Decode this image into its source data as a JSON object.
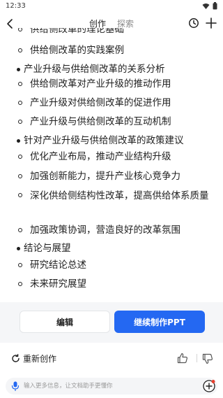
{
  "status_bar": {
    "time": "12:33"
  },
  "header": {
    "tabs": [
      {
        "label": "创作",
        "active": true
      },
      {
        "label": "探索",
        "active": false
      }
    ]
  },
  "outline": {
    "items": [
      {
        "level": 2,
        "text": "供给侧改革的理论基础"
      },
      {
        "level": 2,
        "text": "供给侧改革的实践案例"
      },
      {
        "level": 1,
        "text": "产业升级与供给侧改革的关系分析"
      },
      {
        "level": 2,
        "text": "供给侧改革对产业升级的推动作用"
      },
      {
        "level": 2,
        "text": "产业升级对供给侧改革的促进作用"
      },
      {
        "level": 2,
        "text": "产业升级与供给侧改革的互动机制"
      },
      {
        "level": 1,
        "text": "针对产业升级与供给侧改革的政策建议"
      },
      {
        "level": 2,
        "text": "优化产业布局，推动产业结构升级"
      },
      {
        "level": 2,
        "text": "加强创新能力，提升产业核心竞争力"
      },
      {
        "level": 2,
        "text": "深化供给侧结构性改革，提高供给体系质量"
      },
      {
        "level": 2,
        "text": "加强政策协调，营造良好的改革氛围"
      },
      {
        "level": 1,
        "text": "结论与展望"
      },
      {
        "level": 2,
        "text": "研究结论总述"
      },
      {
        "level": 2,
        "text": "未来研究展望"
      }
    ]
  },
  "actions": {
    "edit_label": "编辑",
    "continue_label": "继续制作PPT"
  },
  "footer": {
    "recreate_label": "重新创作"
  },
  "input": {
    "placeholder": "输入更多信息，让文档助手更懂你"
  },
  "colors": {
    "accent": "#2468f2",
    "text": "#1f1f1f",
    "muted": "#8a8a8a",
    "badge": "#e8402f"
  },
  "icons": [
    "back-arrow-icon",
    "history-clock-icon",
    "plus-icon",
    "refresh-icon",
    "thumbs-up-icon",
    "thumbs-down-icon",
    "microphone-icon",
    "add-circle-icon",
    "wifi-icon",
    "battery-icon"
  ]
}
